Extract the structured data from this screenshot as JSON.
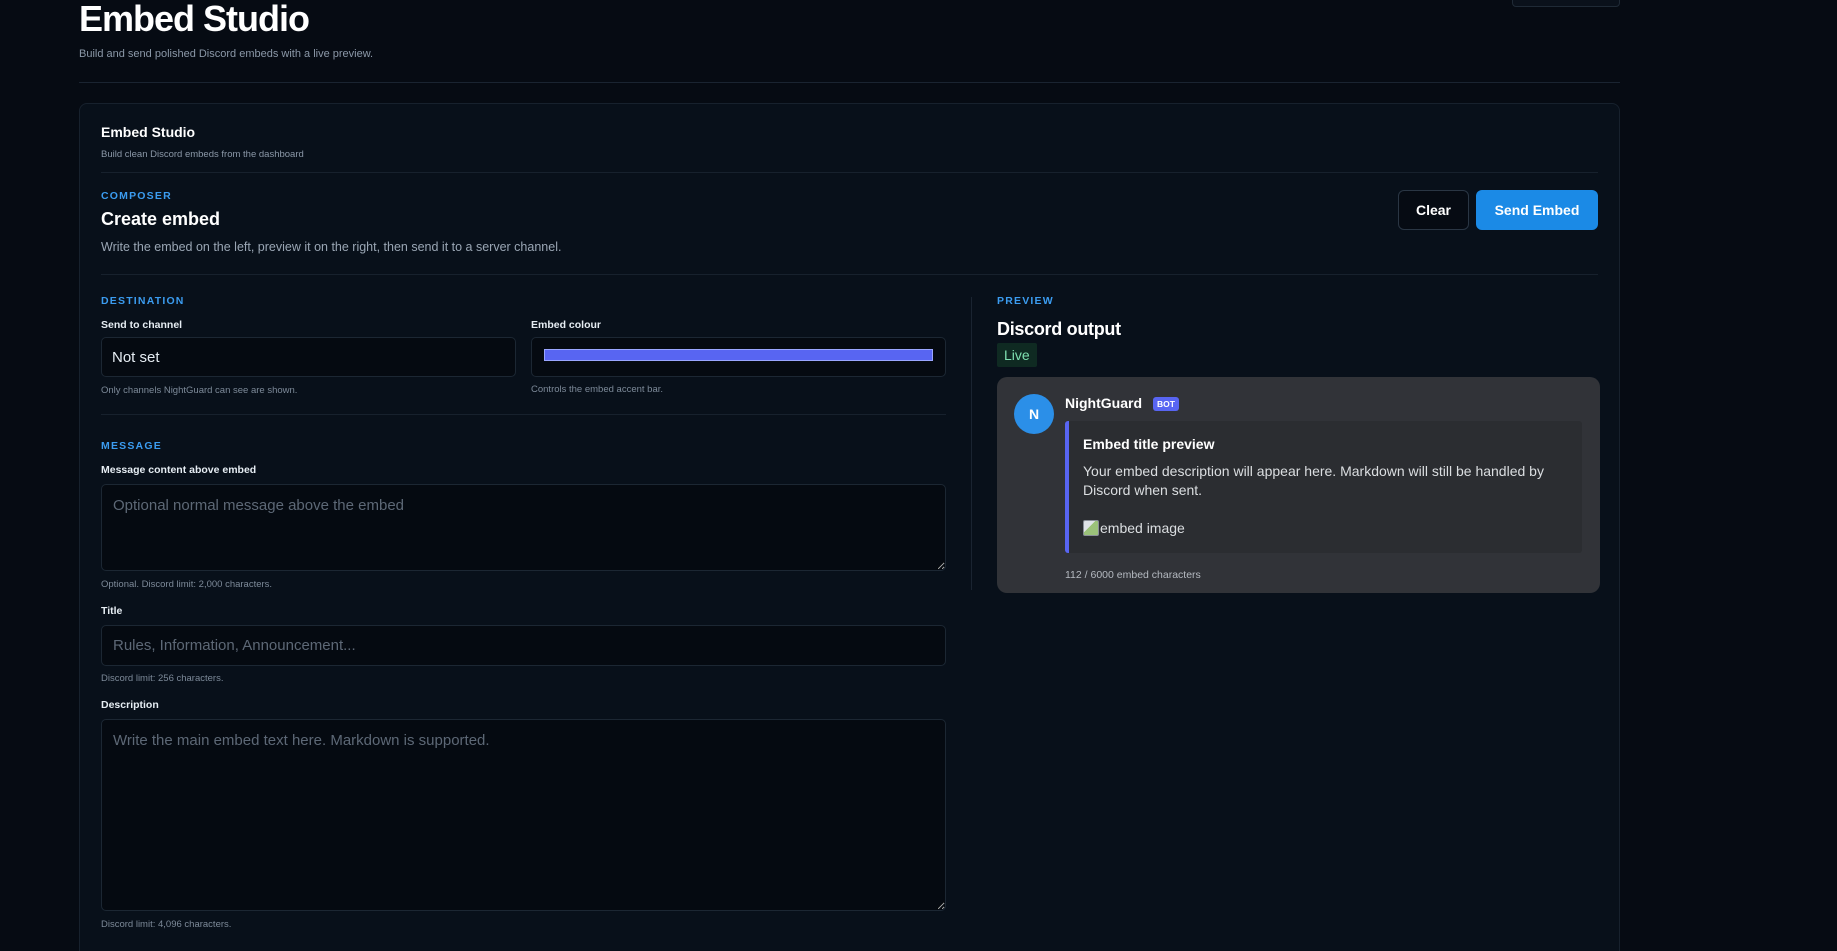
{
  "header": {
    "title": "Embed Studio",
    "subtitle": "Build and send polished Discord embeds with a live preview."
  },
  "card": {
    "title": "Embed Studio",
    "subtitle": "Build clean Discord embeds from the dashboard"
  },
  "composer": {
    "eyebrow": "COMPOSER",
    "title": "Create embed",
    "description": "Write the embed on the left, preview it on the right, then send it to a server channel.",
    "clear_label": "Clear",
    "send_label": "Send Embed"
  },
  "destination": {
    "eyebrow": "DESTINATION",
    "channel_label": "Send to channel",
    "channel_value": "Not set",
    "channel_hint": "Only channels NightGuard can see are shown.",
    "colour_label": "Embed colour",
    "colour_value": "#5865f2",
    "colour_hint": "Controls the embed accent bar."
  },
  "message": {
    "eyebrow": "MESSAGE",
    "content_label": "Message content above embed",
    "content_placeholder": "Optional normal message above the embed",
    "content_hint": "Optional. Discord limit: 2,000 characters.",
    "title_label": "Title",
    "title_placeholder": "Rules, Information, Announcement...",
    "title_hint": "Discord limit: 256 characters.",
    "description_label": "Description",
    "description_placeholder": "Write the main embed text here. Markdown is supported.",
    "description_hint": "Discord limit: 4,096 characters."
  },
  "preview": {
    "eyebrow": "PREVIEW",
    "title": "Discord output",
    "live_badge": "Live",
    "avatar_letter": "N",
    "bot_name": "NightGuard",
    "bot_tag": "BOT",
    "embed_title": "Embed title preview",
    "embed_description": "Your embed description will appear here. Markdown will still be handled by Discord when sent.",
    "embed_image_alt": "embed image",
    "char_count": "112 / 6000 embed characters"
  },
  "colors": {
    "accent": "#3b9cf0",
    "send_button": "#1b8ae6",
    "embed_bar": "#5865f2",
    "discord_bg": "#313338"
  }
}
